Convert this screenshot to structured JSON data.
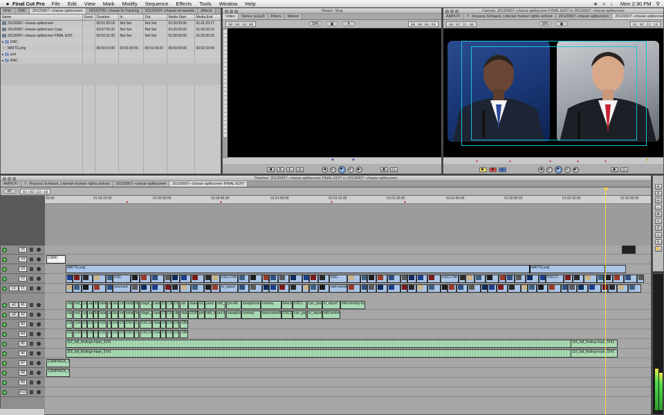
{
  "menubar": {
    "app_name": "Final Cut Pro",
    "menus": [
      "File",
      "Edit",
      "View",
      "Mark",
      "Modify",
      "Sequence",
      "Effects",
      "Tools",
      "Window",
      "Help"
    ],
    "clock": "Mon 2:30 PM"
  },
  "browser": {
    "tabs": [
      "RNC",
      "DNC",
      "20120907--chavar-splitscreen",
      "20120702--chavar-hr-hacking",
      "20121004--chavar-oil-awards",
      "Effects"
    ],
    "columns": [
      "Name",
      "Good",
      "Duration",
      "In",
      "Out",
      "Media Start",
      "Media End"
    ],
    "rows": [
      {
        "name": "20120907--chavar-splitscreen",
        "good": "",
        "duration": "00:01:29:18",
        "in": "Not Set",
        "out": "Not Set",
        "media_start": "01:00:00:00",
        "media_end": "01:01:29:17"
      },
      {
        "name": "20120907--chavar-splitscreen Copy",
        "good": "",
        "duration": "00:07:00:20",
        "in": "Not Set",
        "out": "Not Set",
        "media_start": "01:00:00:00",
        "media_end": "01:06:59:19"
      },
      {
        "name": "20120907--chavar-splitscreen FINAL EDIT",
        "good": "",
        "duration": "00:02:31:00",
        "in": "Not Set",
        "out": "Not Set",
        "media_start": "01:00:00:00",
        "media_end": "01:02:30:23"
      },
      {
        "name": "DNC",
        "good": "",
        "duration": "",
        "in": "",
        "out": "",
        "media_start": "",
        "media_end": ""
      },
      {
        "name": "MATTE.png",
        "good": "",
        "duration": "00:00:10:00",
        "in": "00:01:00:00",
        "out": "00:01:09:23",
        "media_start": "00:00:00:00",
        "media_end": "00:02:10:00"
      },
      {
        "name": "poll",
        "good": "",
        "duration": "",
        "in": "",
        "out": "",
        "media_start": "",
        "media_end": ""
      },
      {
        "name": "RNC",
        "good": "",
        "duration": "",
        "in": "",
        "out": "",
        "media_start": "",
        "media_end": ""
      }
    ]
  },
  "viewer": {
    "title": "Viewer: Slug",
    "tabs": [
      "Video",
      "Stereo (a1a2)",
      "Filters",
      "Motion"
    ],
    "timecode_duration": "00:00:10:00",
    "timecode_current": "00:00:00:00",
    "zoom": "33%"
  },
  "canvas": {
    "title": "Canvas: 20120907--chavar-splitscreen FINAL EDIT in 20120907--chavar-splitscreen",
    "tabs": [
      "AMPUTI",
      "7 - Rozana Schaack, Liberian human rights activist",
      "20120907--chavar-splitscreen",
      "20120907--chavar-splitscreen FINAL EDIT"
    ],
    "timecode_duration": "00:02:31:00",
    "timecode_current": "01:02:22:18",
    "zoom": "33%"
  },
  "timeline": {
    "title": "Timeline: 20120907--chavar-splitscreen FINAL EDIT in 20120907--chavar-splitscreen",
    "tabs": [
      "AMPUTI",
      "7 - Rozana Schaack, Liberian human rights activist",
      "20120907--chavar-splitscreen",
      "20120907--chavar-splitscreen FINAL EDIT"
    ],
    "rt_label": "RT",
    "current_timecode": "01:02:22:18",
    "ruler_ticks": [
      "00:00",
      "01:00:15:00",
      "01:00:30:00",
      "01:00:45:00",
      "01:01:00:00",
      "01:01:15:00",
      "01:01:30:00",
      "01:01:45:00",
      "01:02:00:00",
      "01:02:15:00",
      "01:02:30:00"
    ],
    "video_tracks": [
      "V5",
      "V4",
      "V3",
      "V2",
      "V1"
    ],
    "audio_tracks": [
      "A1",
      "A2",
      "A3",
      "A4",
      "A5",
      "A6",
      "A7",
      "A8",
      "A9",
      "A10"
    ],
    "source_patches": [
      "v1",
      "a1",
      "a2"
    ],
    "clips": {
      "v4_clip": "CAM0",
      "v3_left": "MATTE.png",
      "v3_right": "MATTE.png",
      "v2_labels": [
        "DSC",
        "DSC1708",
        "DSC",
        "DSC1708",
        "DSC17",
        "OBAMA-ACCEPT"
      ],
      "v1_labels": [
        "reserved",
        "tv_report",
        "mitt-romney-bow"
      ],
      "a1_labels": [
        "obama",
        "red_bull",
        "you",
        "saa",
        "fin",
        "balaaa",
        "an",
        "blue",
        "cmp",
        "simple",
        "fe",
        "stage_sas",
        "camp",
        "DSC",
        "CNN",
        "DS",
        "obi",
        "dubai",
        "GOP_vaqu",
        "ports",
        "mitt_ts",
        "pro-life",
        "saxaphone",
        "romney",
        "telecrommitted",
        "DSC1",
        "con_psst",
        "tv_report",
        "mitt-romney-brawe"
      ],
      "a2_labels": [
        "obama",
        "red_bull",
        "you",
        "saa",
        "fin",
        "balaaa",
        "an",
        "blue",
        "cmp",
        "simple",
        "fe",
        "stage_sas",
        "camp",
        "CNN",
        "DS",
        "obi",
        "dubai",
        "GOP_vaqu",
        "ports",
        "mitt_ts",
        "pro-life",
        "saxaphone",
        "romney",
        "telecrommitted",
        "DSC1",
        "con_psst",
        "tv_reporters_1",
        "mitt-romney-brawe"
      ],
      "a3_labels": [
        "DSC1",
        "DSC17",
        "DSC",
        "DSC1701",
        "DSC1",
        "DSC1702",
        "DSC17",
        "DSC1708",
        "DSC1701",
        "DSC1706",
        "DSC1751",
        "DSC1660",
        "Video Seq",
        "DSC16",
        "DSC1673",
        "DSC1710",
        "OBA-WRACCEPT"
      ],
      "a4_labels": [
        "DSC1",
        "DSC17",
        "DSC",
        "DSC1701",
        "DSC1",
        "DSC1702",
        "DSC17",
        "DSC1708",
        "DSC1701",
        "DSC1706",
        "DSC1751",
        "DSC1660",
        "Cross F",
        "DSC16",
        "DSC1673",
        "DSC1710",
        "OBA-WRACCEPT"
      ],
      "a5_label": "116_fall_findings-hope_0141",
      "a5_right": "116_fall_finding-hope_0141",
      "a6_label": "116_fall_findings-hope_0141",
      "a6_right": "116_fall_finding-hope_0141",
      "a7_label": "CAMPAIGN_S",
      "a8_label": "CAMPAIGN_S"
    }
  },
  "colors": {
    "video_clip": "#a9c4e6",
    "audio_clip": "#a9d9b4",
    "playhead": "#f7d64a",
    "safe_area": "#1ac4d9"
  }
}
